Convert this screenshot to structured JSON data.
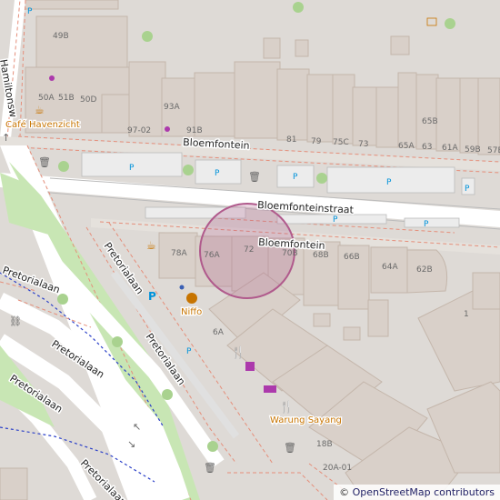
{
  "streets": {
    "bloemfonteinstraat": "Bloemfonteinstraat",
    "bloemfontein_north": "Bloemfontein",
    "bloemfontein_south": "Bloemfontein",
    "pretorialaan_a": "Pretorialaan",
    "pretorialaan_b": "Pretorialaan",
    "pretorialaan_c": "Pretorialaan",
    "pretorialaan_d": "Pretorialaan",
    "pretorialaan_e": "Pretorialaan",
    "pretorialaan_f": "Pretorialaan",
    "pretorialaan_g": "Pretorialaan",
    "top_left_street": "Hamiltonsw",
    "top_left_street_short": "H"
  },
  "pois": {
    "cafe": "Café Havenzicht",
    "niffo": "Niffo",
    "warung": "Warung Sayang"
  },
  "house_numbers": {
    "n49b": "49B",
    "n50a": "50A",
    "n51b": "51B",
    "n50d": "50D",
    "n93a": "93A",
    "n97_02": "97-02",
    "n91b": "91B",
    "n81": "81",
    "n79": "79",
    "n75c": "75C",
    "n73": "73",
    "n65b": "65B",
    "n65a": "65A",
    "n63": "63",
    "n61a": "61A",
    "n59b": "59B",
    "n57": "57E",
    "n78a": "78A",
    "n76a": "76A",
    "n72": "72",
    "n70b": "70B",
    "n68b": "68B",
    "n66b": "66B",
    "n64a": "64A",
    "n62b": "62B",
    "n1": "1",
    "n6a": "6A",
    "n18b": "18B",
    "n20a": "20A-01",
    "n5": "5"
  },
  "symbols": {
    "parking": "P"
  },
  "attribution": {
    "prefix": "© ",
    "link": "OpenStreetMap contributors"
  },
  "colors": {
    "background": "#dedad6",
    "building": "#d9d0c9",
    "building_outline": "#c4b6ab",
    "road": "#ffffff",
    "road_edge": "#e58e7a",
    "park": "#c8e6b4",
    "path_blue": "#2a3fc8",
    "location_circle": "#b05a8c",
    "amenity": "#c77400",
    "shop": "#ac39ac",
    "tree": "#a9d28f"
  }
}
